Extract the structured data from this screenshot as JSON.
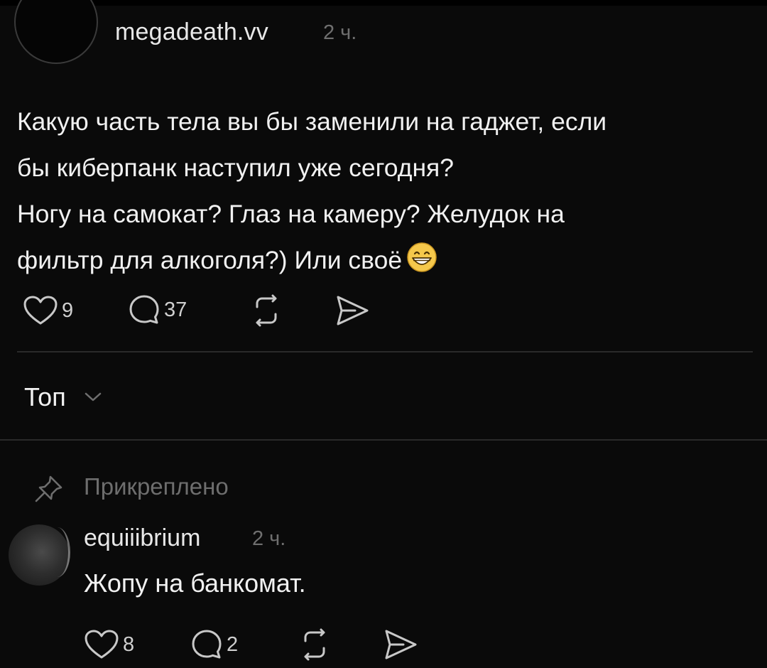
{
  "post": {
    "username": "megadeath.vv",
    "time": "2 ч.",
    "lines": [
      "Какую часть тела вы бы заменили на гаджет, если",
      "бы киберпанк наступил уже сегодня?",
      "Ногу на самокат? Глаз на камеру? Желудок на",
      "фильтр для алкоголя?) Или своё"
    ],
    "emoji": "grinning-face-emoji",
    "likes": "9",
    "comments": "37"
  },
  "sort": {
    "label": "Топ"
  },
  "pinned": {
    "label": "Прикреплено"
  },
  "comment": {
    "username": "equiiibrium",
    "time": "2 ч.",
    "text": "Жопу на банкомат.",
    "likes": "8",
    "comments": "2"
  },
  "colors": {
    "background": "#0a0a0a",
    "text": "#f1f1f1",
    "muted": "#6f6f6f",
    "icon": "#c8c8c8"
  }
}
